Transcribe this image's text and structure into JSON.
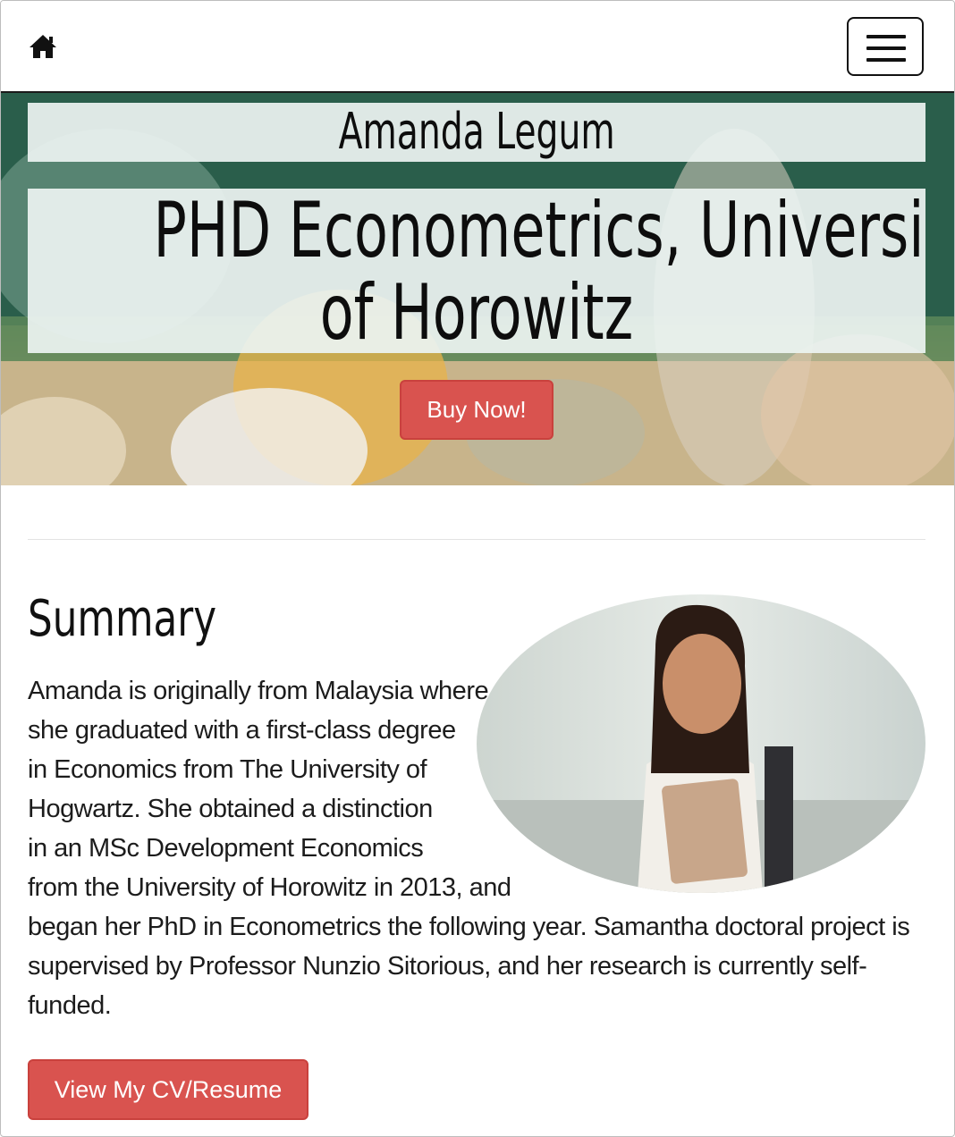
{
  "navbar": {
    "home_icon": "home-icon",
    "menu_icon": "hamburger-menu-icon"
  },
  "hero": {
    "name": "Amanda Legum",
    "degree_line1": "PHD Econometrics, University",
    "degree_line2": "of Horowitz",
    "cta_label": "Buy Now!"
  },
  "summary": {
    "title": "Summary",
    "body": "Amanda is originally from Malaysia where she graduated with a first-class degree in Economics from The University of Hogwartz. She obtained a distinction in an MSc Development Economics from the University of Horowitz in 2013, and began her PhD in Econometrics the following year. Samantha doctoral project is supervised by Professor Nunzio Sitorious, and her research is currently self-funded.",
    "cv_button_label": "View My CV/Resume"
  },
  "colors": {
    "accent": "#d9534f",
    "text": "#111111"
  }
}
